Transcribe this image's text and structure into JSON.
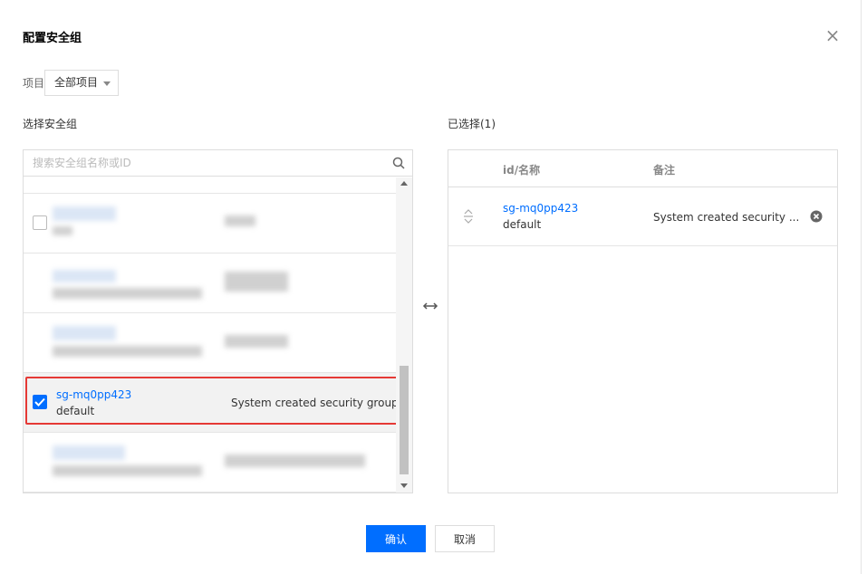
{
  "dialog": {
    "title": "配置安全组",
    "close_icon": "close-icon"
  },
  "project": {
    "label": "项目",
    "selected": "全部项目"
  },
  "left": {
    "section_title": "选择安全组",
    "search_placeholder": "搜索安全组名称或ID",
    "selected_row": {
      "id": "sg-mq0pp423",
      "name": "default",
      "note": "System created security group",
      "checked": true
    }
  },
  "right": {
    "section_title": "已选择(1)",
    "col_id": "id/名称",
    "col_note": "备注",
    "rows": [
      {
        "id": "sg-mq0pp423",
        "name": "default",
        "note": "System created security ..."
      }
    ]
  },
  "footer": {
    "ok_label": "确认",
    "cancel_label": "取消"
  },
  "colors": {
    "primary": "#006eff",
    "highlight_border": "#e53935"
  }
}
